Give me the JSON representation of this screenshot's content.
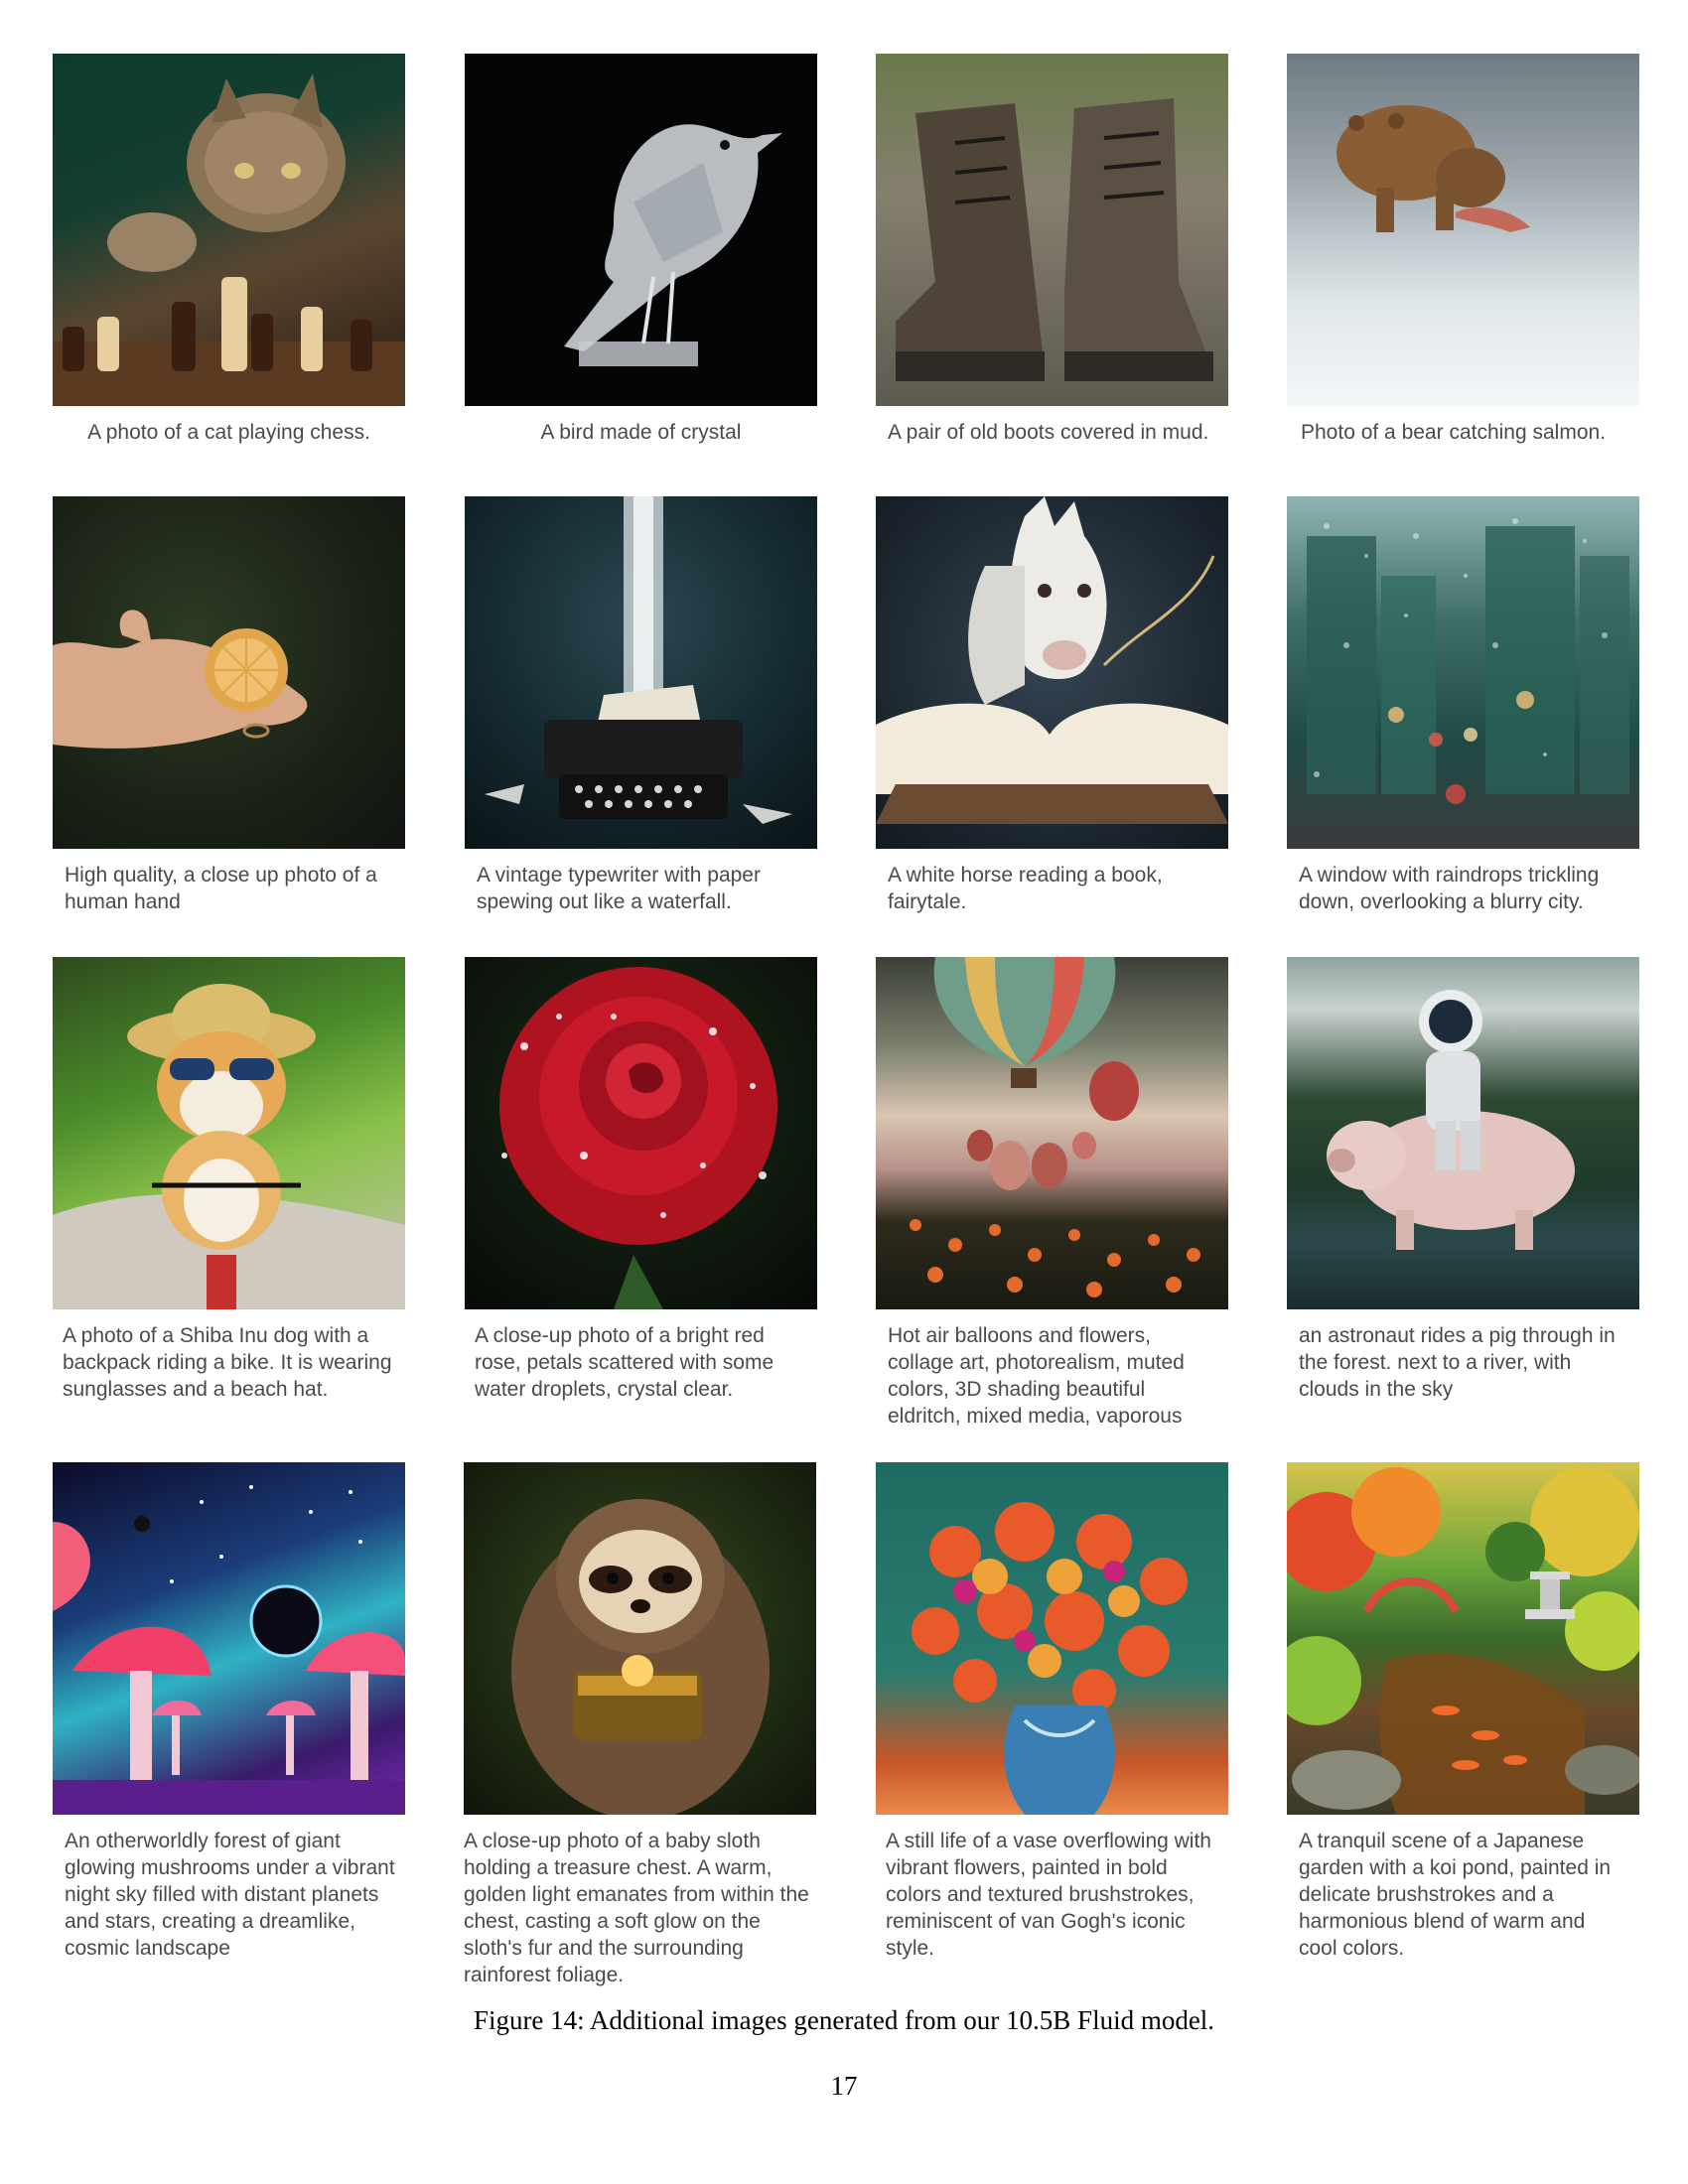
{
  "figure": {
    "caption": "Figure 14: Additional images generated from our 10.5B Fluid model.",
    "page_number": "17"
  },
  "images": [
    {
      "caption": "A photo of a cat playing chess."
    },
    {
      "caption": "A bird made of crystal"
    },
    {
      "caption": "A pair of old boots covered in mud."
    },
    {
      "caption": "Photo of a bear catching salmon."
    },
    {
      "caption": "High quality, a close up photo of a human hand"
    },
    {
      "caption": "A vintage typewriter with paper spewing out like a waterfall."
    },
    {
      "caption": "A white horse reading a book, fairytale."
    },
    {
      "caption": "A window with raindrops trickling down, overlooking a blurry city."
    },
    {
      "caption": "A photo of a Shiba Inu dog with a backpack riding a bike. It is wearing sunglasses and a beach hat."
    },
    {
      "caption": "A close-up photo of a bright red rose, petals scattered with some water droplets, crystal clear."
    },
    {
      "caption": "Hot air balloons and flowers, collage art, photorealism, muted colors, 3D shading beautiful eldritch, mixed media, vaporous"
    },
    {
      "caption": "an astronaut rides a pig through in the forest. next to a river, with clouds in the sky"
    },
    {
      "caption": "An otherworldly forest of giant glowing mushrooms under a vibrant night sky filled with distant planets and stars, creating a dreamlike, cosmic landscape"
    },
    {
      "caption": "A close-up photo of a baby sloth holding a treasure chest. A warm, golden light emanates from within the chest, casting a soft glow on the sloth's fur and the surrounding rainforest foliage."
    },
    {
      "caption": "A still life of a vase overflowing with vibrant flowers, painted in bold colors and textured brushstrokes, reminiscent of van Gogh's iconic style."
    },
    {
      "caption": "A tranquil scene of a Japanese garden with a koi pond, painted in delicate brushstrokes and a harmonious blend of warm and cool colors."
    }
  ]
}
